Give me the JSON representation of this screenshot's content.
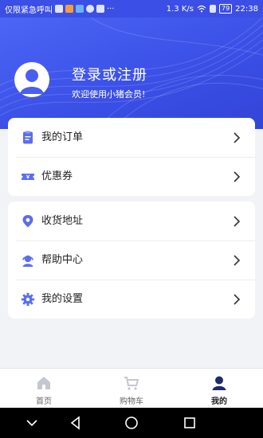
{
  "status_bar": {
    "carrier": "仅限紧急呼叫",
    "speed": "1.3 K/s",
    "battery": "79",
    "time": "22:38"
  },
  "header": {
    "title": "登录或注册",
    "subtitle": "欢迎使用小猪会员!"
  },
  "menu_group_1": [
    {
      "label": "我的订单",
      "icon": "order-icon"
    },
    {
      "label": "优惠券",
      "icon": "coupon-icon"
    }
  ],
  "menu_group_2": [
    {
      "label": "收货地址",
      "icon": "location-icon"
    },
    {
      "label": "帮助中心",
      "icon": "support-icon"
    },
    {
      "label": "我的设置",
      "icon": "gear-icon"
    }
  ],
  "tabbar": {
    "items": [
      {
        "label": "首页",
        "icon": "home-icon",
        "active": false
      },
      {
        "label": "购物车",
        "icon": "cart-icon",
        "active": false
      },
      {
        "label": "我的",
        "icon": "user-icon",
        "active": true
      }
    ]
  },
  "colors": {
    "brand": "#3b4fe6",
    "icon": "#5b6df0",
    "inactive_tab": "#c4c7cf",
    "active_tab": "#1f2a66"
  }
}
